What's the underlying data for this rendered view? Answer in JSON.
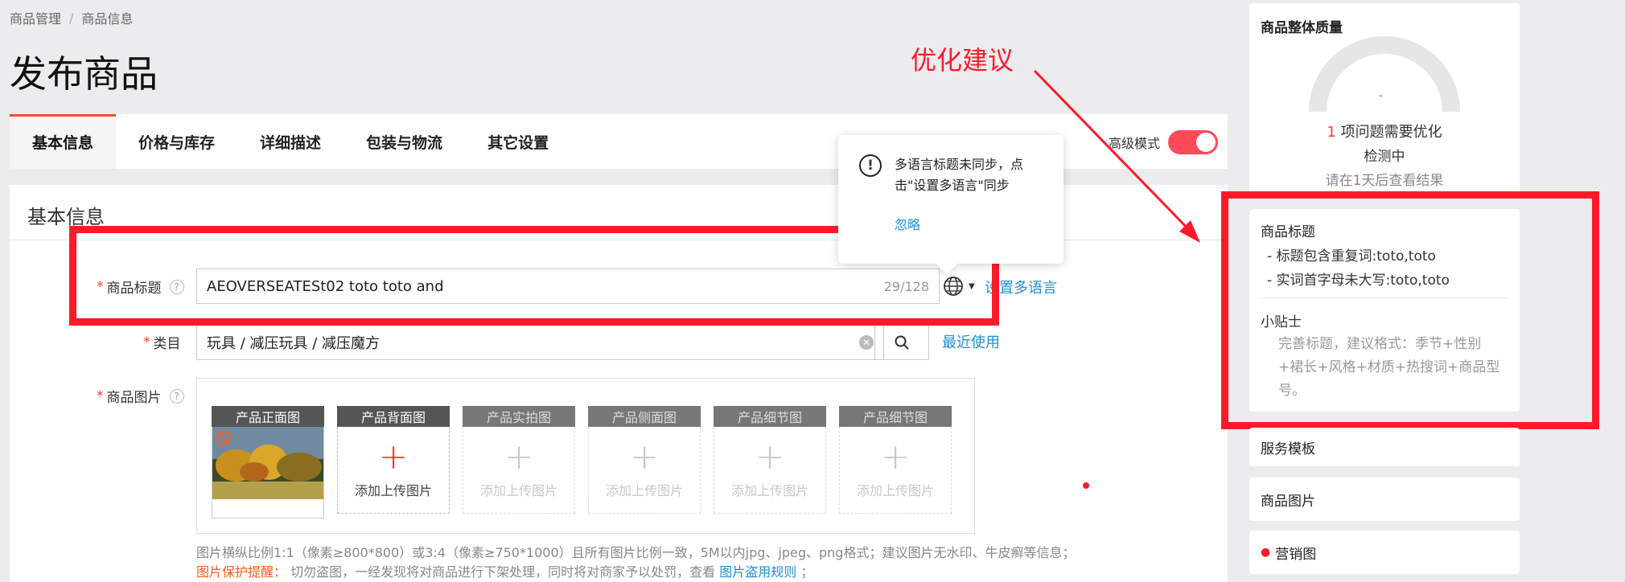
{
  "breadcrumb": [
    "商品管理",
    "商品信息"
  ],
  "page_title": "发布商品",
  "tabs": [
    "基本信息",
    "价格与库存",
    "详细描述",
    "包装与物流",
    "其它设置"
  ],
  "advanced_mode_label": "高级模式",
  "section_title": "基本信息",
  "form": {
    "title_label": "商品标题",
    "title_value": "AEOVERSEATESt02 toto toto and",
    "title_counter": "29/128",
    "set_multilang_link": "设置多语言",
    "category_label": "类目",
    "category_value": "玩具 / 减压玩具 / 减压魔方",
    "recent_link": "最近使用",
    "image_label": "商品图片"
  },
  "image_slots": [
    {
      "label": "产品正面图",
      "filled": true
    },
    {
      "label": "产品背面图",
      "add_text": "添加上传图片",
      "enabled": true
    },
    {
      "label": "产品实拍图",
      "add_text": "添加上传图片",
      "enabled": false
    },
    {
      "label": "产品侧面图",
      "add_text": "添加上传图片",
      "enabled": false
    },
    {
      "label": "产品细节图",
      "add_text": "添加上传图片",
      "enabled": false
    },
    {
      "label": "产品细节图",
      "add_text": "添加上传图片",
      "enabled": false
    }
  ],
  "image_hint": "图片横纵比例1:1（像素≥800*800）或3:4（像素≥750*1000）且所有图片比例一致，5M以内jpg、jpeg、png格式；建议图片无水印、牛皮癣等信息；",
  "protect": {
    "label": "图片保护提醒：",
    "text": "切勿盗图，一经发现将对商品进行下架处理，同时将对商家予以处罚，查看",
    "link": "图片盗用规则",
    "tail": "；"
  },
  "popover": {
    "message": "多语言标题未同步，点击\"设置多语言\"同步",
    "ignore": "忽略"
  },
  "annotation_label": "优化建议",
  "quality": {
    "title": "商品整体质量",
    "gauge_value": "-",
    "issue_count": "1",
    "issue_text": "项问题需要优化",
    "status": "检测中",
    "hint": "请在1天后查看结果"
  },
  "suggestion": {
    "title": "商品标题",
    "items": [
      "- 标题包含重复词:toto,toto",
      "- 实词首字母未大写:toto,toto"
    ],
    "tip_title": "小贴士",
    "tip_text": "完善标题，建议格式：季节+性别+裙长+风格+材质+热搜词+商品型号。"
  },
  "right_items": [
    "服务模板",
    "商品图片",
    "营销图"
  ],
  "colors": {
    "accent": "#ff4a2b",
    "annotation_red": "#ff1a2a",
    "link": "#1d8fd8",
    "toggle": "#ff4a5a"
  }
}
